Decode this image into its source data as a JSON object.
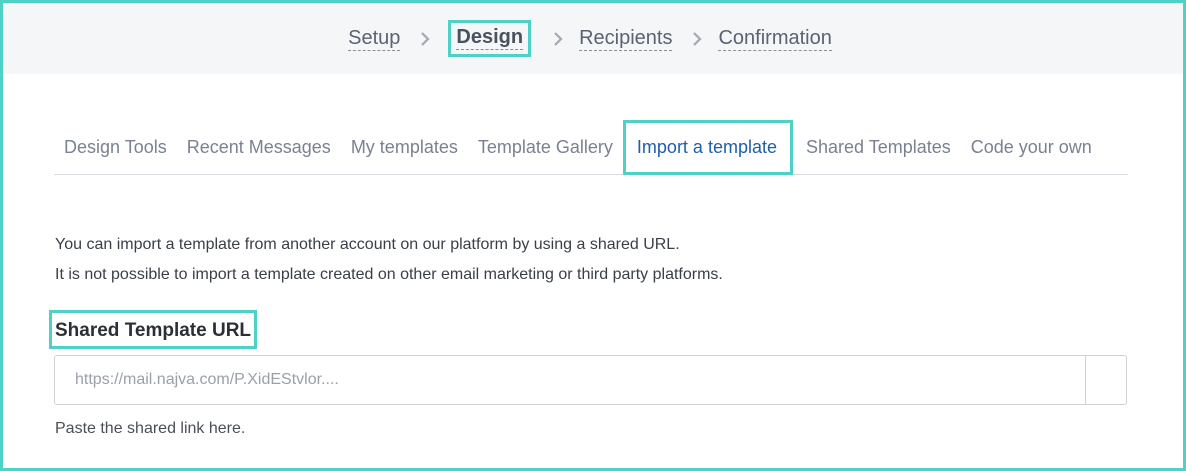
{
  "steps": [
    {
      "label": "Setup"
    },
    {
      "label": "Design"
    },
    {
      "label": "Recipients"
    },
    {
      "label": "Confirmation"
    }
  ],
  "active_step": "Design",
  "tabs": [
    {
      "label": "Design Tools"
    },
    {
      "label": "Recent Messages"
    },
    {
      "label": "My templates"
    },
    {
      "label": "Template Gallery"
    },
    {
      "label": "Import a template"
    },
    {
      "label": "Shared Templates"
    },
    {
      "label": "Code your own"
    }
  ],
  "active_tab": "Import a template",
  "description": {
    "line1": "You can import a template from another account on our platform by using a shared URL.",
    "line2": "It is not possible to import a template created on other email marketing or third party platforms."
  },
  "field": {
    "label": "Shared Template URL",
    "value": "",
    "placeholder": "https://mail.najva.com/P.XidEStvlor....",
    "help": "Paste the shared link here."
  },
  "icons": {
    "step_separator": "chevron-right-icon"
  },
  "colors": {
    "highlight": "#4fd1c5",
    "active_tab_text": "#1f5fa8",
    "step_bar_bg": "#f5f6f8"
  }
}
